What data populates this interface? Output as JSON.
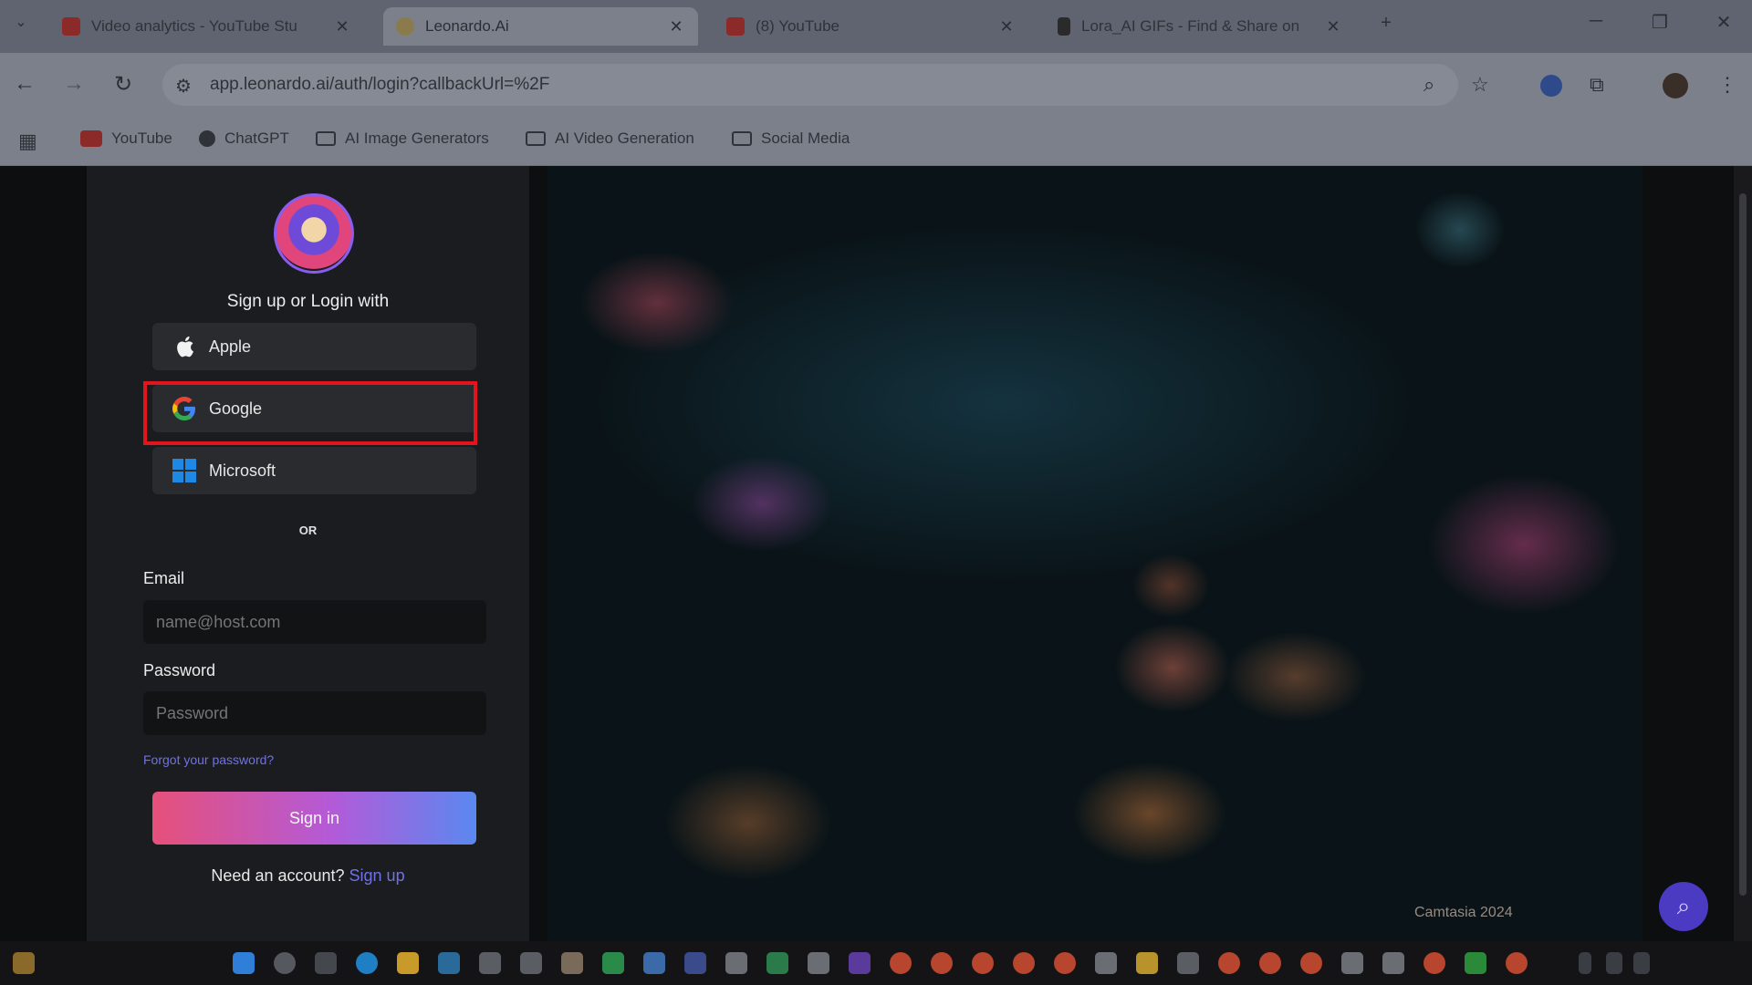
{
  "browser": {
    "tabs": [
      {
        "title": "Video analytics - YouTube Stu",
        "active": false,
        "favicon_color": "#c0392b"
      },
      {
        "title": "Leonardo.Ai",
        "active": true,
        "favicon_color": "#c9a45a"
      },
      {
        "title": "(8) YouTube",
        "active": false,
        "favicon_color": "#c0392b"
      },
      {
        "title": "Lora_AI GIFs - Find & Share on",
        "active": false,
        "favicon_color": "#222"
      }
    ],
    "new_tab": "+",
    "window_controls": {
      "minimize": "─",
      "restore": "❐",
      "close": "✕"
    },
    "url": "app.leonardo.ai/auth/login?callbackUrl=%2F",
    "bookmarks": [
      {
        "label": "YouTube",
        "type": "youtube"
      },
      {
        "label": "ChatGPT",
        "type": "chatgpt"
      },
      {
        "label": "AI Image Generators",
        "type": "folder"
      },
      {
        "label": "AI Video Generation",
        "type": "folder"
      },
      {
        "label": "Social Media",
        "type": "folder"
      }
    ]
  },
  "login": {
    "heading": "Sign up or Login with",
    "providers": [
      {
        "label": "Apple",
        "icon": "apple-icon"
      },
      {
        "label": "Google",
        "icon": "google-icon"
      },
      {
        "label": "Microsoft",
        "icon": "microsoft-icon"
      }
    ],
    "divider": "OR",
    "email_label": "Email",
    "email_placeholder": "name@host.com",
    "password_label": "Password",
    "password_placeholder": "Password",
    "forgot": "Forgot your password?",
    "signin": "Sign in",
    "need_account": "Need an account?",
    "signup": "Sign up"
  },
  "overlay": {
    "watermark": "Camtasia 2024",
    "highlight_color": "#e2141c"
  },
  "colors": {
    "accent_link": "#6f72e6",
    "signin_gradient": [
      "#e6507a",
      "#b45ad8",
      "#5a88f0"
    ]
  }
}
